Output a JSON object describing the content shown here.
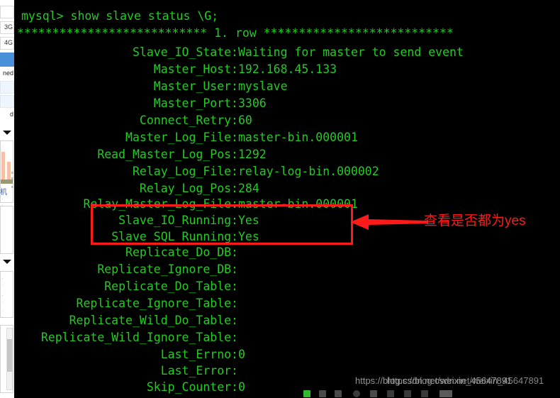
{
  "terminal": {
    "prompt_line": "mysql> show slave status \\G;",
    "row_header": "*************************** 1. row ***************************",
    "fields": [
      {
        "label": "Slave_IO_State:",
        "value": "Waiting for master to send event"
      },
      {
        "label": "Master_Host:",
        "value": "192.168.45.133"
      },
      {
        "label": "Master_User:",
        "value": "myslave"
      },
      {
        "label": "Master_Port:",
        "value": "3306"
      },
      {
        "label": "Connect_Retry:",
        "value": "60"
      },
      {
        "label": "Master_Log_File:",
        "value": "master-bin.000001"
      },
      {
        "label": "Read_Master_Log_Pos:",
        "value": "1292"
      },
      {
        "label": "Relay_Log_File:",
        "value": "relay-log-bin.000002"
      },
      {
        "label": "Relay_Log_Pos:",
        "value": "284"
      },
      {
        "label": "Relay_Master_Log_File:",
        "value": "master-bin.000001"
      },
      {
        "label": "Slave_IO_Running:",
        "value": "Yes"
      },
      {
        "label": "Slave_SQL_Running:",
        "value": "Yes"
      },
      {
        "label": "Replicate_Do_DB:",
        "value": ""
      },
      {
        "label": "Replicate_Ignore_DB:",
        "value": ""
      },
      {
        "label": "Replicate_Do_Table:",
        "value": ""
      },
      {
        "label": "Replicate_Ignore_Table:",
        "value": ""
      },
      {
        "label": "Replicate_Wild_Do_Table:",
        "value": ""
      },
      {
        "label": "Replicate_Wild_Ignore_Table:",
        "value": ""
      },
      {
        "label": "Last_Errno:",
        "value": "0"
      },
      {
        "label": "Last_Error:",
        "value": ""
      },
      {
        "label": "Skip_Counter:",
        "value": "0"
      }
    ],
    "text_color": "#22cc22",
    "background_color": "#000000"
  },
  "annotation": {
    "note_text": "查看是否都为yes",
    "color": "#ff1a1a",
    "arrow_icon": "arrow-left-icon"
  },
  "watermarks": {
    "primary": "https://blog.csdn.net/weixin_45647891",
    "secondary": "https://blog.csdn.net/weixin_45647891"
  },
  "background_app": {
    "labels": [
      "3G",
      "4G",
      "ned",
      "d"
    ],
    "chinese_fragment": "机",
    "caret_icon": "caret-down-icon"
  }
}
